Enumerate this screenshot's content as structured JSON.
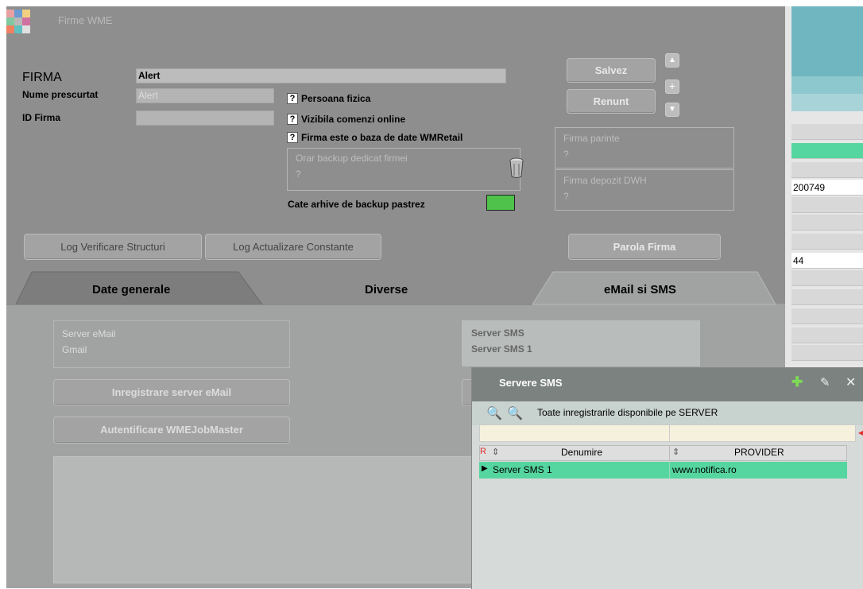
{
  "window": {
    "title": "Firme WME"
  },
  "form": {
    "firma_label": "FIRMA",
    "firma_value": "Alert",
    "nume_label": "Nume prescurtat",
    "nume_value": "Alert",
    "id_label": "ID Firma",
    "id_value": "",
    "q": "?",
    "check1": "Persoana fizica",
    "check2": "Vizibila comenzi online",
    "check3": "Firma este o baza de date WMRetail",
    "orar_label": "Orar backup dedicat  firmei",
    "orar_value": "?",
    "arhive_label": "Cate arhive de backup pastrez",
    "firma_parinte_label": "Firma parinte",
    "firma_parinte_value": "?",
    "firma_depozit_label": "Firma depozit DWH",
    "firma_depozit_value": "?"
  },
  "buttons": {
    "salvez": "Salvez",
    "renunt": "Renunt",
    "log_verificare": "Log Verificare Structuri",
    "log_actualizare": "Log Actualizare Constante",
    "parola_firma": "Parola Firma",
    "inregistrare_email": "Inregistrare server eMail",
    "autentificare": "Autentificare WMEJobMaster"
  },
  "tabs": [
    {
      "label": "Date generale"
    },
    {
      "label": "Diverse"
    },
    {
      "label": "eMail si SMS"
    }
  ],
  "email_tab": {
    "server_email_label": "Server eMail",
    "server_email_value": "Gmail",
    "server_sms_label": "Server SMS",
    "server_sms_value": "Server SMS 1"
  },
  "background_app": {
    "row1": "200749",
    "row2": "44"
  },
  "dialog": {
    "title": "Servere SMS",
    "filter_text": "Toate inregistrarile disponibile pe SERVER",
    "columns": [
      "Denumire",
      "PROVIDER"
    ],
    "r_marker": "R",
    "rows": [
      {
        "denumire": "Server SMS 1",
        "provider": "www.notifica.ro"
      }
    ]
  },
  "colors": {
    "accent_green": "#55d59f",
    "arhive_green": "#4ec24a"
  }
}
